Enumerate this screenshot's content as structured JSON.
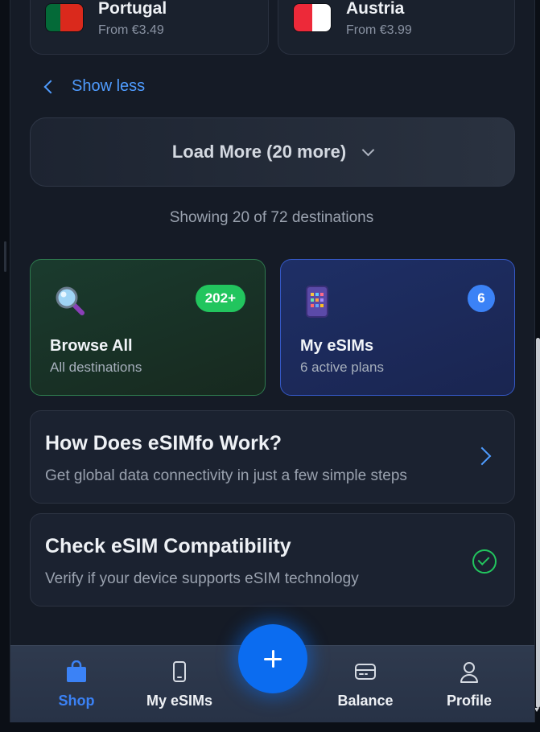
{
  "countries": [
    {
      "name": "Portugal",
      "price": "From €3.49",
      "flag_colors": [
        "#046a38",
        "#da291c"
      ]
    },
    {
      "name": "Austria",
      "price": "From €3.99",
      "flag_colors": [
        "#ed2939",
        "#ffffff"
      ]
    }
  ],
  "show_less_label": "Show less",
  "load_more_label": "Load More (20 more)",
  "showing_text": "Showing 20 of 72 destinations",
  "tiles": {
    "browse": {
      "title": "Browse All",
      "subtitle": "All destinations",
      "badge": "202+",
      "icon": "magnifier-icon"
    },
    "esims": {
      "title": "My eSIMs",
      "subtitle": "6 active plans",
      "badge": "6",
      "icon": "phone-icon"
    }
  },
  "info_cards": {
    "how": {
      "title": "How Does eSIMfo Work?",
      "subtitle": "Get global data connectivity in just a few simple steps"
    },
    "compat": {
      "title": "Check eSIM Compatibility",
      "subtitle": "Verify if your device supports eSIM technology"
    }
  },
  "nav": {
    "items": [
      {
        "label": "Shop",
        "icon": "shopping-bag-icon",
        "active": true
      },
      {
        "label": "My eSIMs",
        "icon": "smartphone-icon",
        "active": false
      },
      {
        "label": "Balance",
        "icon": "wallet-icon",
        "active": false
      },
      {
        "label": "Profile",
        "icon": "user-icon",
        "active": false
      }
    ],
    "fab_icon": "plus-icon"
  },
  "colors": {
    "accent": "#3b82f6",
    "success": "#22c55e",
    "background": "#151b26"
  }
}
